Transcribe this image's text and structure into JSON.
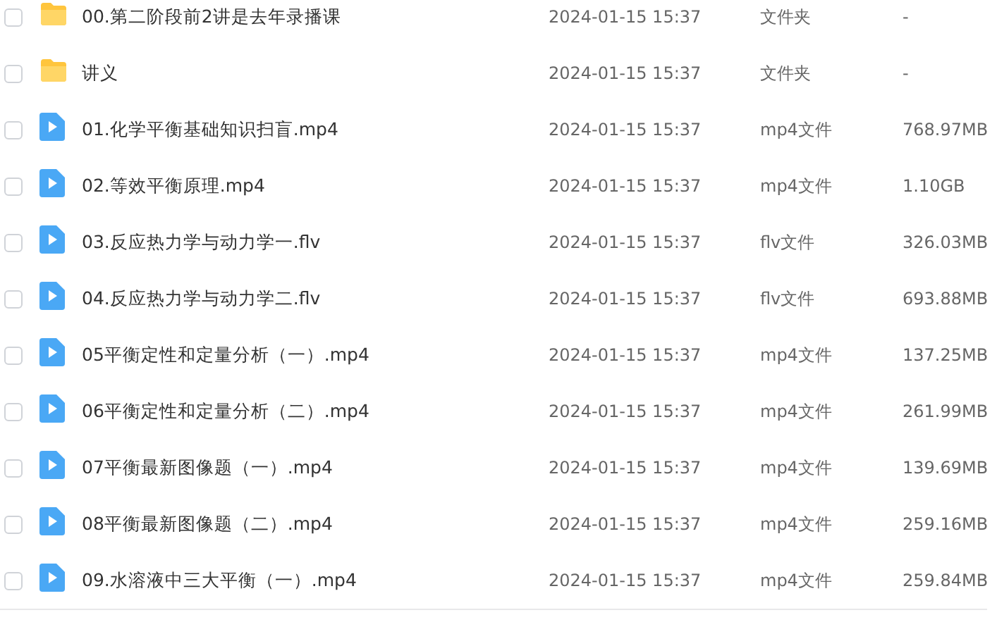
{
  "files": [
    {
      "kind": "folder",
      "checked": false,
      "name": "00.第二阶段前2讲是去年录播课",
      "modified": "2024-01-15 15:37",
      "type": "文件夹",
      "size": "-"
    },
    {
      "kind": "folder",
      "checked": false,
      "name": "讲义",
      "modified": "2024-01-15 15:37",
      "type": "文件夹",
      "size": "-"
    },
    {
      "kind": "video",
      "checked": false,
      "name": "01.化学平衡基础知识扫盲.mp4",
      "modified": "2024-01-15 15:37",
      "type": "mp4文件",
      "size": "768.97MB"
    },
    {
      "kind": "video",
      "checked": false,
      "name": "02.等效平衡原理.mp4",
      "modified": "2024-01-15 15:37",
      "type": "mp4文件",
      "size": "1.10GB"
    },
    {
      "kind": "video",
      "checked": false,
      "name": "03.反应热力学与动力学一.flv",
      "modified": "2024-01-15 15:37",
      "type": "flv文件",
      "size": "326.03MB"
    },
    {
      "kind": "video",
      "checked": false,
      "name": "04.反应热力学与动力学二.flv",
      "modified": "2024-01-15 15:37",
      "type": "flv文件",
      "size": "693.88MB"
    },
    {
      "kind": "video",
      "checked": false,
      "name": "05平衡定性和定量分析（一）.mp4",
      "modified": "2024-01-15 15:37",
      "type": "mp4文件",
      "size": "137.25MB"
    },
    {
      "kind": "video",
      "checked": false,
      "name": "06平衡定性和定量分析（二）.mp4",
      "modified": "2024-01-15 15:37",
      "type": "mp4文件",
      "size": "261.99MB"
    },
    {
      "kind": "video",
      "checked": false,
      "name": "07平衡最新图像题（一）.mp4",
      "modified": "2024-01-15 15:37",
      "type": "mp4文件",
      "size": "139.69MB"
    },
    {
      "kind": "video",
      "checked": false,
      "name": "08平衡最新图像题（二）.mp4",
      "modified": "2024-01-15 15:37",
      "type": "mp4文件",
      "size": "259.16MB"
    },
    {
      "kind": "video",
      "checked": false,
      "name": "09.水溶液中三大平衡（一）.mp4",
      "modified": "2024-01-15 15:37",
      "type": "mp4文件",
      "size": "259.84MB"
    }
  ]
}
